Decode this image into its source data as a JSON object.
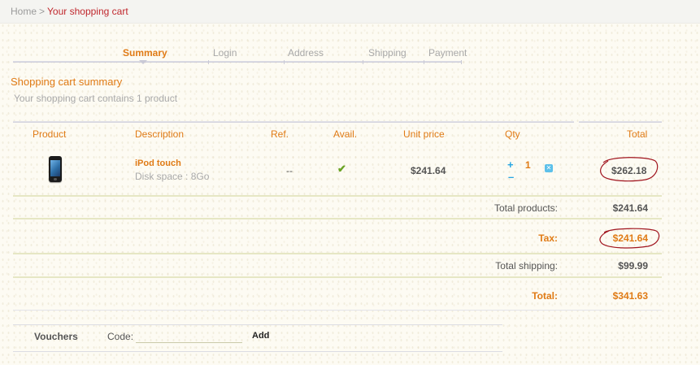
{
  "breadcrumb": {
    "home": "Home",
    "separator": ">",
    "current": "Your shopping cart"
  },
  "steps": [
    {
      "label": "Summary",
      "active": true
    },
    {
      "label": "Login",
      "active": false
    },
    {
      "label": "Address",
      "active": false
    },
    {
      "label": "Shipping",
      "active": false
    },
    {
      "label": "Payment",
      "active": false
    }
  ],
  "summary": {
    "title": "Shopping cart summary",
    "count_text": "Your shopping cart contains 1 product"
  },
  "table": {
    "headers": [
      "Product",
      "Description",
      "Ref.",
      "Avail.",
      "Unit price",
      "Qty",
      "Total"
    ],
    "rows": [
      {
        "image_icon": "ipod-touch-image",
        "name": "iPod touch",
        "description": "Disk space : 8Go",
        "ref": "--",
        "avail_icon": "checkmark-icon",
        "avail_glyph": "✔",
        "unit_price": "$241.64",
        "qty": "1",
        "qty_plus": "+",
        "qty_minus": "–",
        "delete_glyph": "✕",
        "total": "$262.18"
      }
    ]
  },
  "totals": {
    "products_label": "Total products:",
    "products_value": "$241.64",
    "tax_label": "Tax:",
    "tax_value": "$241.64",
    "shipping_label": "Total shipping:",
    "shipping_value": "$99.99",
    "total_label": "Total:",
    "total_value": "$341.63"
  },
  "vouchers": {
    "title": "Vouchers",
    "code_label": "Code:",
    "code_value": "",
    "add_label": "Add"
  },
  "colors": {
    "accent": "#e07b16",
    "breadcrumb_current": "#c0272d",
    "annotation_circle": "#a0141e",
    "check": "#6aa324",
    "qty_control": "#28a6e3"
  }
}
